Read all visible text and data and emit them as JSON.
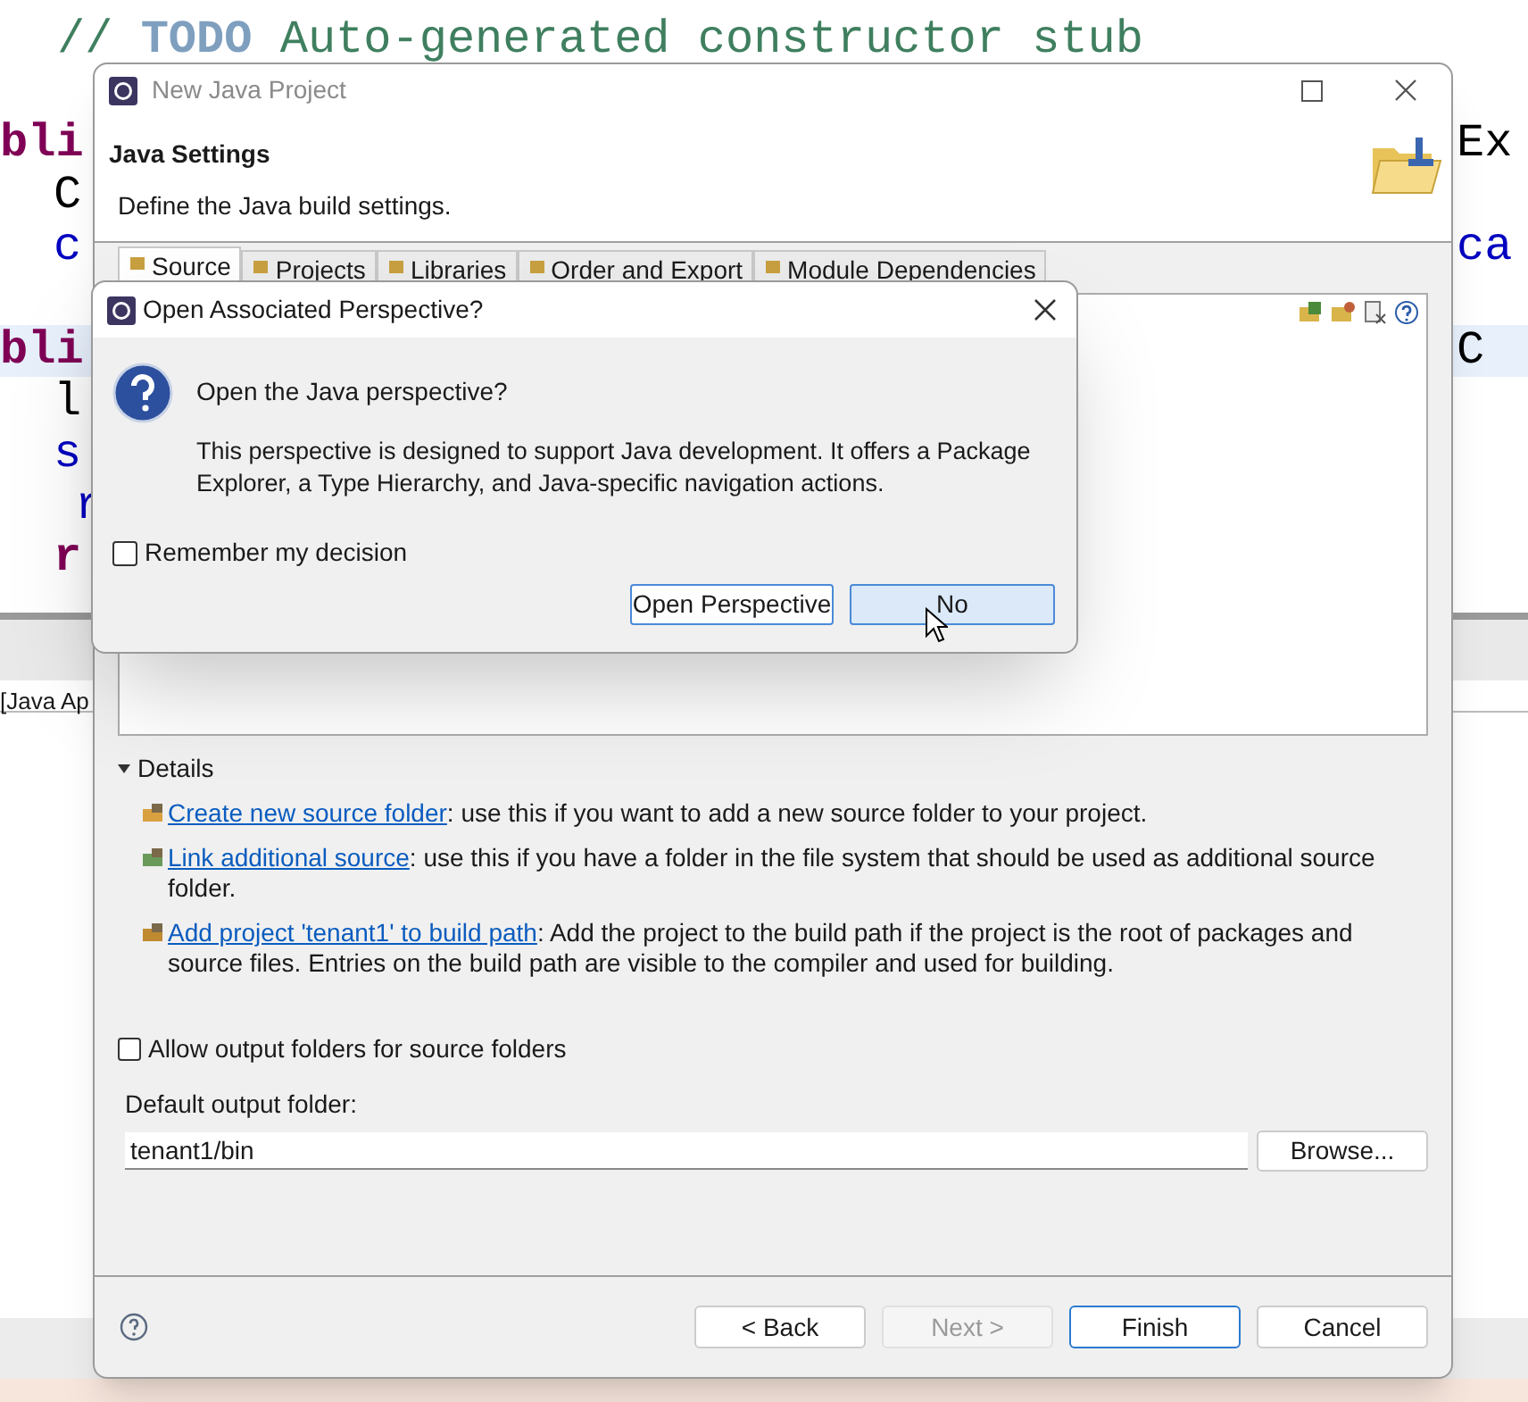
{
  "editor": {
    "lines": [
      {
        "left": {
          "text": "// **TODO** Auto-generated constructor stub",
          "kind": "comment"
        },
        "highlighted": false
      },
      {
        "left": {
          "text": "bli",
          "kind": "keyword"
        },
        "right": {
          "text": "Ex",
          "kind": "plain"
        },
        "highlighted": false
      },
      {
        "left": {
          "text": "C",
          "kind": "plain"
        },
        "highlighted": false
      },
      {
        "left": {
          "text": "c",
          "kind": "field"
        },
        "right": {
          "text": "ca",
          "kind": "field"
        },
        "highlighted": false
      },
      {
        "left": {
          "text": "bli",
          "kind": "keyword"
        },
        "right": {
          "text": "C",
          "kind": "plain"
        },
        "highlighted": true
      },
      {
        "left": {
          "text": "l",
          "kind": "plain"
        },
        "highlighted": false
      },
      {
        "left": {
          "text": "s",
          "kind": "field"
        },
        "highlighted": false
      },
      {
        "left": {
          "text": "r",
          "kind": "field"
        },
        "highlighted": false
      },
      {
        "left": {
          "text": "r",
          "kind": "keyword"
        },
        "highlighted": false
      }
    ],
    "console_tab": "[Java Ap"
  },
  "wizard": {
    "title": "New Java Project",
    "header_title": "Java Settings",
    "header_description": "Define the Java build settings.",
    "tabs": [
      {
        "label": "Source",
        "selected": true
      },
      {
        "label": "Projects",
        "selected": false
      },
      {
        "label": "Libraries",
        "selected": false
      },
      {
        "label": "Order and Export",
        "selected": false
      },
      {
        "label": "Module Dependencies",
        "selected": false
      }
    ],
    "details": {
      "label": "Details",
      "expanded": true,
      "items": [
        {
          "link": "Create new source folder",
          "text": ": use this if you want to add a new source folder to your project."
        },
        {
          "link": "Link additional source",
          "text": ": use this if you have a folder in the file system that should be used as additional source folder."
        },
        {
          "link": "Add project 'tenant1' to build path",
          "text": ": Add the project to the build path if the project is the root of packages and source files. Entries on the build path are visible to the compiler and used for building."
        }
      ]
    },
    "allow_output": {
      "label": "Allow output folders for source folders",
      "checked": false
    },
    "output_folder": {
      "label": "Default output folder:",
      "value": "tenant1/bin",
      "browse": "Browse..."
    },
    "buttons": [
      {
        "label": "< Back",
        "disabled": false,
        "default": false
      },
      {
        "label": "Next >",
        "disabled": true,
        "default": false
      },
      {
        "label": "Finish",
        "disabled": false,
        "default": true
      },
      {
        "label": "Cancel",
        "disabled": false,
        "default": false
      }
    ]
  },
  "prompt": {
    "title": "Open Associated Perspective?",
    "question": "Open the Java perspective?",
    "message": "This perspective is designed to support Java development. It offers a Package Explorer, a Type Hierarchy, and Java-specific navigation actions.",
    "remember": {
      "label": "Remember my decision",
      "checked": false
    },
    "buttons": [
      {
        "label": "Open Perspective",
        "hovered": false
      },
      {
        "label": "No",
        "hovered": true
      }
    ]
  }
}
